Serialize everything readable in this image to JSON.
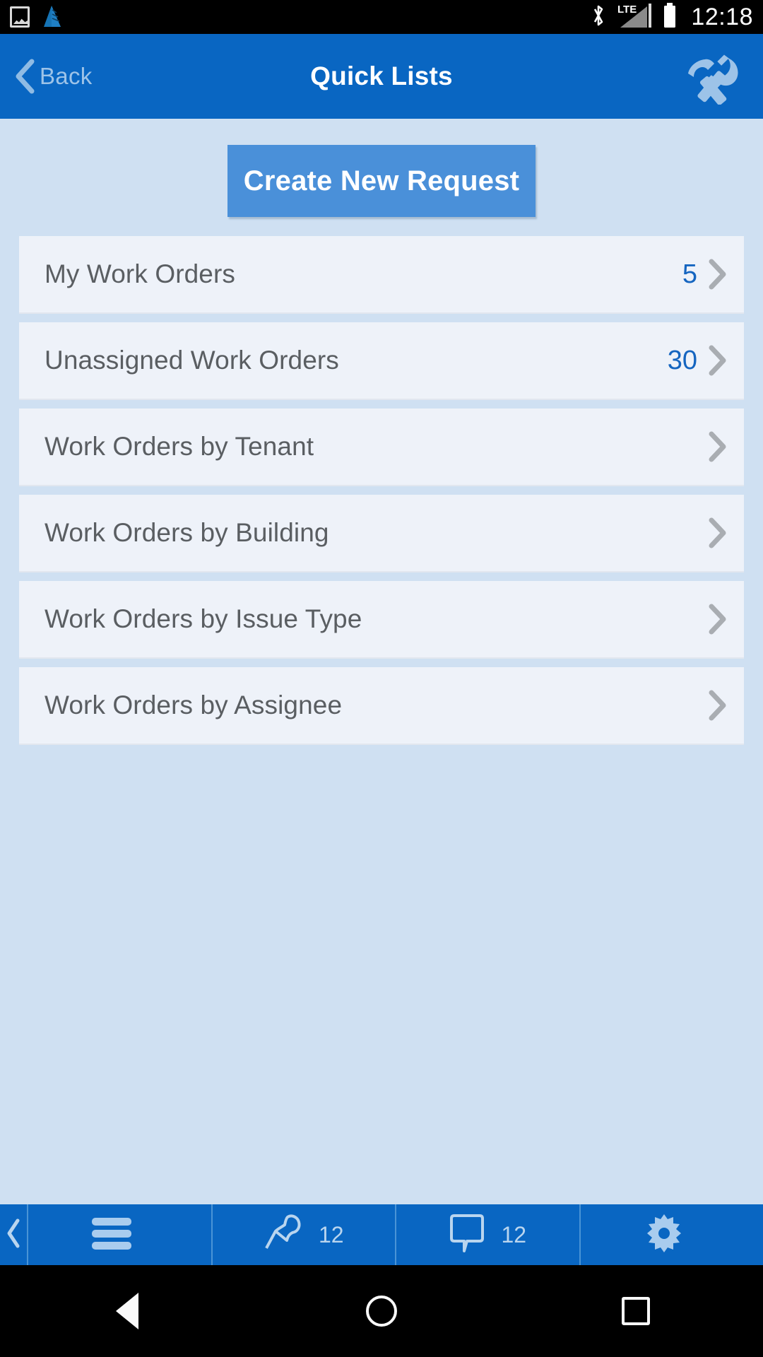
{
  "status_bar": {
    "time": "12:18",
    "left_icons": [
      "gallery-icon",
      "app-pyramid-icon"
    ],
    "right_icons": [
      "bluetooth-icon",
      "lte-label",
      "signal-icon",
      "battery-icon"
    ],
    "network_label": "LTE"
  },
  "header": {
    "back_label": "Back",
    "title": "Quick Lists",
    "action_icon": "tools-icon"
  },
  "main": {
    "cta_label": "Create New Request",
    "rows": [
      {
        "label": "My Work Orders",
        "count": "5"
      },
      {
        "label": "Unassigned Work Orders",
        "count": "30"
      },
      {
        "label": "Work Orders by Tenant",
        "count": ""
      },
      {
        "label": "Work Orders by Building",
        "count": ""
      },
      {
        "label": "Work Orders by Issue Type",
        "count": ""
      },
      {
        "label": "Work Orders by Assignee",
        "count": ""
      }
    ]
  },
  "bottom_nav": {
    "collapse_icon": "chevron-left-icon",
    "items": [
      {
        "icon": "hamburger-menu-icon",
        "badge": ""
      },
      {
        "icon": "pin-icon",
        "badge": "12"
      },
      {
        "icon": "chat-bubble-icon",
        "badge": "12"
      },
      {
        "icon": "gear-icon",
        "badge": ""
      }
    ]
  },
  "system_nav": {
    "back": "back-triangle-icon",
    "home": "home-circle-icon",
    "recents": "recents-square-icon"
  },
  "colors": {
    "header_blue": "#0966c2",
    "body_blue": "#cfe0f2",
    "cta_blue": "#4a90d9",
    "row_bg": "#eef2f9",
    "count_blue": "#1565c0",
    "row_text": "#5a5e62",
    "icon_light_blue": "#9dc3e8"
  }
}
